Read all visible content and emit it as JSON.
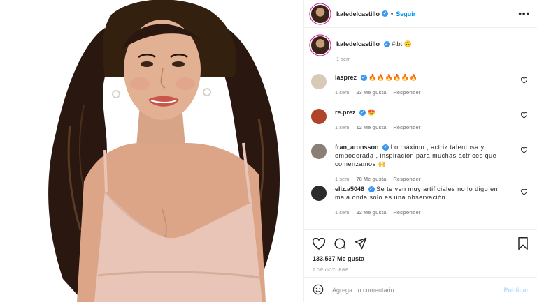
{
  "post": {
    "author": "katedelcastillo",
    "follow_label": "Seguir",
    "more_label": "•••",
    "separator": "•",
    "verified_mark": "✓"
  },
  "caption": {
    "user": "katedelcastillo",
    "text": "#tbt 🙃",
    "time": "1 sem"
  },
  "comments": [
    {
      "user": "lasprez",
      "text": "🔥🔥🔥🔥🔥🔥",
      "time": "1 sem",
      "likes": "23 Me gusta",
      "reply": "Responder",
      "avatar_color": "#d8c9b8"
    },
    {
      "user": "re.prez",
      "text": "😍",
      "time": "1 sem",
      "likes": "12 Me gusta",
      "reply": "Responder",
      "avatar_color": "#b0442a"
    },
    {
      "user": "fran_aronsson",
      "text": "Lo máximo , actriz talentosa y empoderada , inspiración para muchas actrices que comenzamos 🙌",
      "time": "1 sem",
      "likes": "78 Me gusta",
      "reply": "Responder",
      "avatar_color": "#8a7f76"
    },
    {
      "user": "eliz.a5048",
      "text": "Se te ven muy artificiales no lo digo en mala onda solo es una observación",
      "time": "1 sem",
      "likes": "22 Me gusta",
      "reply": "Responder",
      "avatar_color": "#2c2c2c"
    }
  ],
  "actions": {
    "likes": "133,537 Me gusta",
    "date": "7 DE OCTUBRE"
  },
  "composer": {
    "placeholder": "Agrega un comentario...",
    "publish_label": "Publicar"
  },
  "icons": {
    "like": "heart-icon",
    "comment": "comment-icon",
    "share": "share-icon",
    "save": "bookmark-icon",
    "emoji": "emoji-icon",
    "more": "more-options-icon",
    "verified": "verified-badge-icon"
  },
  "colors": {
    "link_blue": "#0095f6",
    "verified_blue": "#3897f0",
    "muted": "#8e8e8e",
    "publish_disabled": "#b2dffc",
    "story_ring": "#d6249f"
  }
}
